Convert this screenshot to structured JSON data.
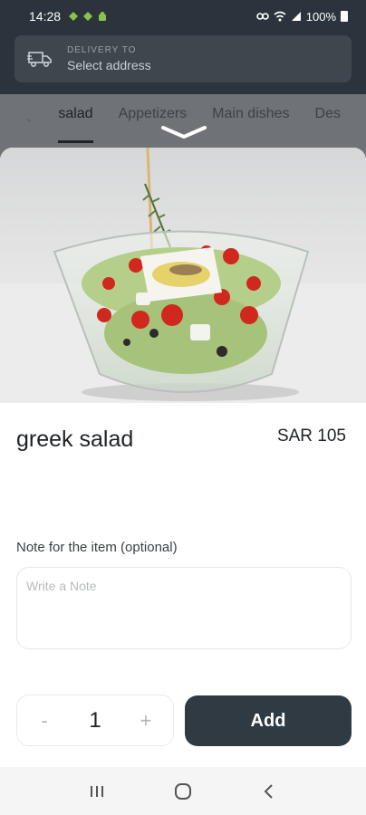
{
  "status_bar": {
    "time": "14:28",
    "battery": "100%",
    "left_icons": [
      "android-icon",
      "android-icon",
      "android-icon"
    ],
    "right_icons": [
      "link-icon",
      "wifi-icon",
      "signal-icon",
      "battery-icon"
    ]
  },
  "header": {
    "delivery_label": "DELIVERY TO",
    "delivery_value": "Select address",
    "icon": "delivery-truck-icon"
  },
  "tabs": {
    "items": [
      {
        "label": "salad",
        "active": true
      },
      {
        "label": "Appetizers",
        "active": false
      },
      {
        "label": "Main dishes",
        "active": false
      },
      {
        "label": "Des",
        "active": false
      }
    ]
  },
  "item": {
    "name": "greek salad",
    "price": "SAR 105",
    "note_label": "Note for the item (optional)",
    "note_placeholder": "Write a Note",
    "note_value": "",
    "quantity": "1",
    "minus_label": "-",
    "plus_label": "+",
    "add_label": "Add"
  },
  "colors": {
    "dark": "#2b343c",
    "add_button": "#2f3a43",
    "overlay": "#6f7276",
    "android_green": "#8bc34a"
  }
}
